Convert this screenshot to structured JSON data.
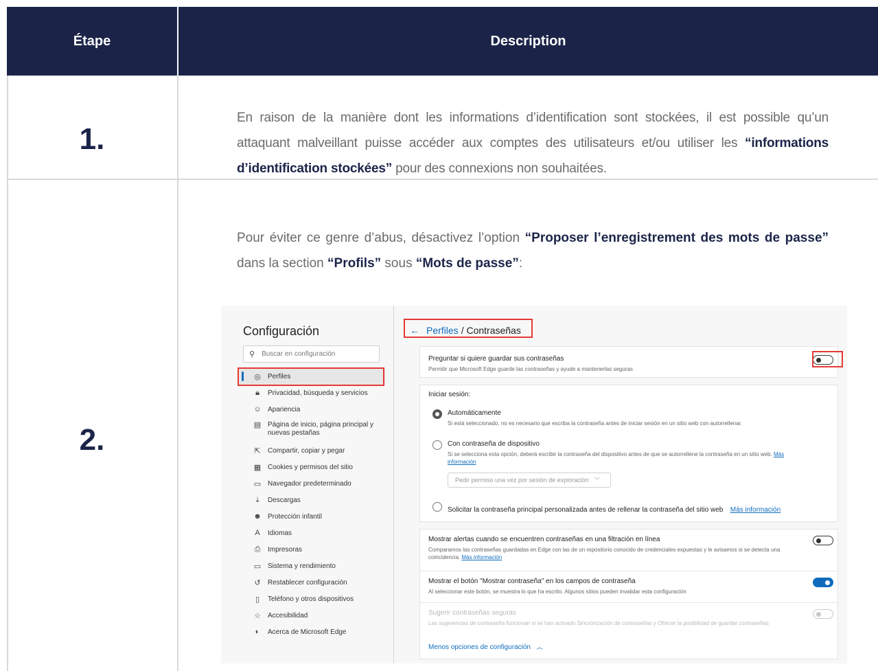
{
  "table": {
    "header_step": "Étape",
    "header_description": "Description"
  },
  "steps": [
    {
      "num": "1.",
      "text_before": "En raison de la manière dont les informations d’identification sont stockées, il est possible qu’un attaquant malveillant puisse accéder aux comptes des utilisateurs et/ou utiliser les ",
      "bold": "“informations d’identification stockées”",
      "text_after": " pour des connexions non souhaitées."
    },
    {
      "num": "2.",
      "t1": "Pour éviter ce genre d’abus, désactivez l’option ",
      "b1": "“Proposer l’enregistrement des mots de passe”",
      "t2": " dans la section ",
      "b2": "“Profils”",
      "t3": " sous ",
      "b3": "“Mots de passe”",
      "t4": ":"
    }
  ],
  "screenshot": {
    "title": "Configuración",
    "search_placeholder": "Buscar en configuración",
    "nav": [
      {
        "icon": "profile-icon",
        "glyph": "◎",
        "label": "Perfiles",
        "selected": true
      },
      {
        "icon": "lock-icon",
        "glyph": "🔒︎",
        "label": "Privacidad, búsqueda y servicios"
      },
      {
        "icon": "appearance-icon",
        "glyph": "☺",
        "label": "Apariencia"
      },
      {
        "icon": "home-page-icon",
        "glyph": "▤",
        "label": "Página de inicio, página principal y nuevas pestañas"
      },
      {
        "icon": "share-icon",
        "glyph": "⇱",
        "label": "Compartir, copiar y pegar"
      },
      {
        "icon": "cookies-icon",
        "glyph": "▦",
        "label": "Cookies y permisos del sitio"
      },
      {
        "icon": "browser-icon",
        "glyph": "▭",
        "label": "Navegador predeterminado"
      },
      {
        "icon": "download-icon",
        "glyph": "⤓",
        "label": "Descargas"
      },
      {
        "icon": "family-icon",
        "glyph": "☻",
        "label": "Protección infantil"
      },
      {
        "icon": "language-icon",
        "glyph": "A",
        "label": "Idiomas"
      },
      {
        "icon": "printer-icon",
        "glyph": "⎙",
        "label": "Impresoras"
      },
      {
        "icon": "system-icon",
        "glyph": "▭",
        "label": "Sistema y rendimiento"
      },
      {
        "icon": "reset-icon",
        "glyph": "↺",
        "label": "Restablecer configuración"
      },
      {
        "icon": "phone-icon",
        "glyph": "▯",
        "label": "Teléfono y otros dispositivos"
      },
      {
        "icon": "accessibility-icon",
        "glyph": "☆",
        "label": "Accesibilidad"
      },
      {
        "icon": "edge-icon",
        "glyph": "◐",
        "label": "Acerca de Microsoft Edge"
      }
    ],
    "breadcrumb_link": "Perfiles",
    "breadcrumb_current": "/ Contraseñas",
    "offer_save_title": "Preguntar si quiere guardar sus contraseñas",
    "offer_save_sub": "Permitir que Microsoft Edge guarde las contraseñas y ayude a mantenerlas seguras",
    "offer_save_state": "off",
    "signin_heading": "Iniciar sesión:",
    "auto_title": "Automáticamente",
    "auto_sub": "Si está seleccionado, no es necesario que escriba la contraseña antes de iniciar sesión en un sitio web con autorrellenar.",
    "device_title": "Con contraseña de dispositivo",
    "device_sub": "Si se selecciona esta opción, deberá escribir la contraseña del dispositivo antes de que se autorrellene la contraseña en un sitio web.",
    "device_more_1": "Más",
    "device_more_2": "información",
    "device_select": "Pedir permiso una vez por sesión de exploración",
    "custom_title": "Solicitar la contraseña principal personalizada antes de rellenar la contraseña del sitio web",
    "custom_more": "Más información",
    "leak_title": "Mostrar alertas cuando se encuentren contraseñas en una filtración en línea",
    "leak_sub": "Comparamos las contraseñas guardadas en Edge con las de un repositorio conocido de credenciales expuestas y le avisamos si se detecta una coincidencia.",
    "leak_more": "Más información",
    "leak_state": "off",
    "reveal_title": "Mostrar el botón \"Mostrar contraseña\" en los campos de contraseña",
    "reveal_sub": "Al seleccionar este botón, se muestra lo que ha escrito. Algunos sitios pueden invalidar esta configuración",
    "reveal_state": "on",
    "suggest_title": "Sugerir contraseñas seguras",
    "suggest_sub": "Las sugerencias de contraseña funcionan si se han activado Sincronización de contraseñas y Ofrecer la posibilidad de guardar contraseñas",
    "suggest_state": "disabled",
    "less_options": "Menos opciones de configuración",
    "accent_color": "#0f6cbd",
    "highlight_color": "#e53935"
  },
  "colors": {
    "header_bg": "#1b2448",
    "emphasis": "#1b2448",
    "body_text": "#6b6b6b"
  }
}
